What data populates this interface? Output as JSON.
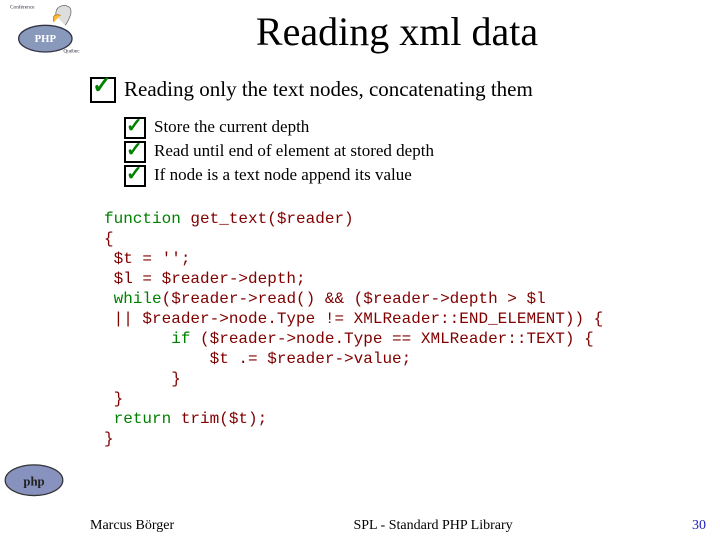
{
  "title": "Reading xml data",
  "lead": "Reading only the text nodes, concatenating them",
  "subpoints": [
    "Store the current depth",
    "Read until end of element at stored depth",
    "If node is a text node append its value"
  ],
  "code": {
    "kw_function": "function",
    "fn_sig": " get_text($reader)",
    "l1": "{",
    "l2": " $t = '';",
    "l3": " $l = $reader->depth;",
    "kw_while": "while",
    "l4": "($reader->read() && ($reader->depth > $l",
    "l5": " || $reader->node.Type != XMLReader::END_ELEMENT)) {",
    "kw_if": "if",
    "l6": " ($reader->node.Type == XMLReader::TEXT) {",
    "l7": "           $t .= $reader->value;",
    "l8": "       }",
    "l9": " }",
    "kw_return": "return",
    "l10": " trim($t);",
    "l11": "}"
  },
  "footer": {
    "author": "Marcus Börger",
    "center": "SPL - Standard PHP Library",
    "page": "30"
  },
  "icons": {
    "top_left": "conference-php-quebec-logo",
    "bottom_left": "php-logo"
  }
}
